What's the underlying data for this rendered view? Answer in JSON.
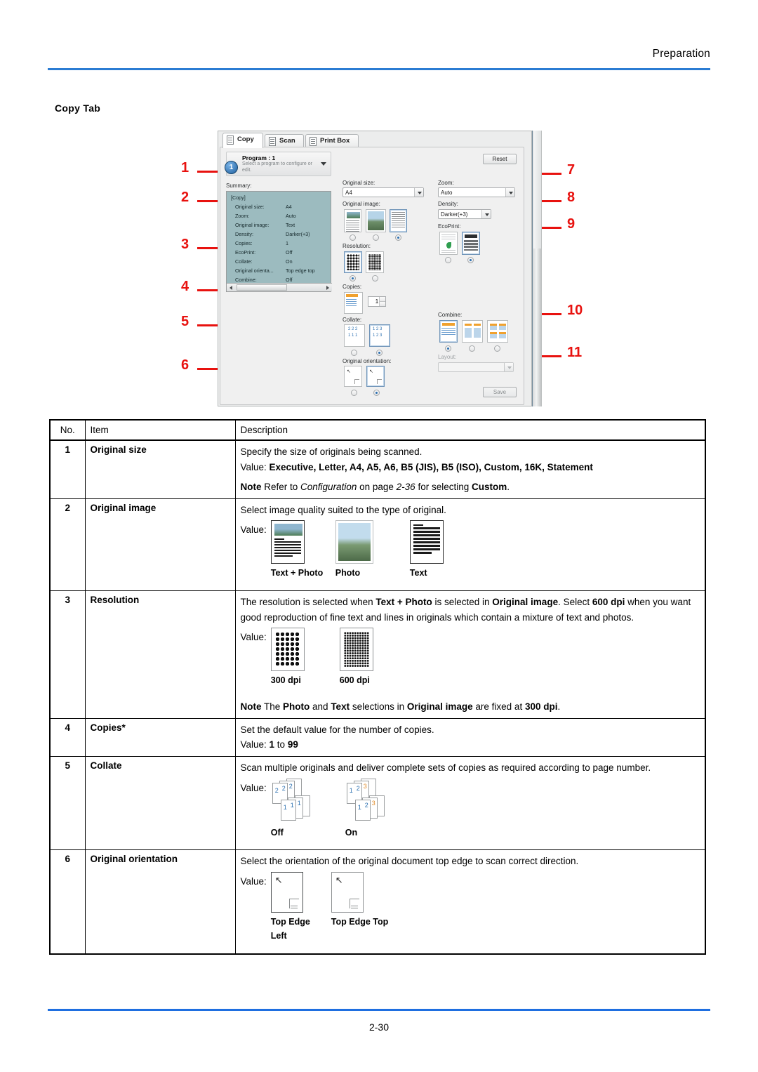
{
  "page": {
    "header_title": "Preparation",
    "section_title": "Copy Tab",
    "footer_page": "2-30",
    "accent_color": "#2b7cd3",
    "callout_color": "#e8120f"
  },
  "callouts": {
    "left": [
      "1",
      "2",
      "3",
      "4",
      "5",
      "6"
    ],
    "right": [
      "7",
      "8",
      "9",
      "10",
      "11"
    ]
  },
  "screenshot": {
    "tabs": [
      {
        "label": "Copy",
        "icon": "document-icon",
        "active": true
      },
      {
        "label": "Scan",
        "icon": "scanner-icon",
        "active": false
      },
      {
        "label": "Print Box",
        "icon": "printbox-icon",
        "active": false
      }
    ],
    "program": {
      "title": "Program : 1",
      "subtitle": "Select a program to configure or edit.",
      "badge": "1"
    },
    "reset_button": "Reset",
    "save_button": "Save",
    "summary": {
      "label": "Summary:",
      "group": "[Copy]",
      "rows": [
        {
          "key": "Original size:",
          "value": "A4"
        },
        {
          "key": "Zoom:",
          "value": "Auto"
        },
        {
          "key": "Original image:",
          "value": "Text"
        },
        {
          "key": "Density:",
          "value": "Darker(+3)"
        },
        {
          "key": "Copies:",
          "value": "1"
        },
        {
          "key": "EcoPrint:",
          "value": "Off"
        },
        {
          "key": "Collate:",
          "value": "On"
        },
        {
          "key": "Original orienta...",
          "value": "Top edge top"
        },
        {
          "key": "Combine:",
          "value": "Off"
        }
      ]
    },
    "fields": {
      "original_size_label": "Original size:",
      "original_size_value": "A4",
      "original_image_label": "Original image:",
      "resolution_label": "Resolution:",
      "copies_label": "Copies:",
      "copies_value": "1",
      "collate_label": "Collate:",
      "original_orientation_label": "Original orientation:",
      "zoom_label": "Zoom:",
      "zoom_value": "Auto",
      "density_label": "Density:",
      "density_value": "Darker(+3)",
      "ecoprint_label": "EcoPrint:",
      "combine_label": "Combine:",
      "layout_label": "Layout:",
      "layout_value": ""
    }
  },
  "table": {
    "headers": {
      "no": "No.",
      "item": "Item",
      "description": "Description"
    },
    "rows": [
      {
        "no": "1",
        "item": "Original size",
        "line1": "Specify the size of originals being scanned.",
        "value_prefix": "Value: ",
        "value_bold": "Executive, Letter, A4, A5, A6, B5 (JIS), B5 (ISO), Custom, 16K, Statement",
        "note_label": "Note",
        "note_pre": "  Refer to ",
        "note_italic": "Configuration",
        "note_mid": " on page ",
        "note_italic2": "2-36",
        "note_post": " for selecting ",
        "note_bold": "Custom",
        "note_end": "."
      },
      {
        "no": "2",
        "item": "Original image",
        "line1": "Select image quality suited to the type of original.",
        "value_label": "Value:",
        "options": [
          {
            "caption": "Text + Photo",
            "art": "text-photo-icon"
          },
          {
            "caption": "Photo",
            "art": "photo-icon"
          },
          {
            "caption": "Text",
            "art": "text-icon"
          }
        ]
      },
      {
        "no": "3",
        "item": "Resolution",
        "p_a": "The resolution is selected when ",
        "p_b": "Text + Photo",
        "p_c": " is selected in ",
        "p_d": "Original image",
        "p_e": ". Select ",
        "p_f": "600 dpi",
        "p_g": " when you want good reproduction of fine text and lines in originals which contain a mixture of text and photos.",
        "value_label": "Value:",
        "options": [
          {
            "caption": "300 dpi",
            "art": "halftone-300-icon"
          },
          {
            "caption": "600 dpi",
            "art": "halftone-600-icon"
          }
        ],
        "note_label": "Note",
        "n_a": "  The ",
        "n_b": "Photo",
        "n_c": " and ",
        "n_d": "Text",
        "n_e": " selections in ",
        "n_f": "Original image",
        "n_g": " are fixed at ",
        "n_h": "300 dpi",
        "n_i": "."
      },
      {
        "no": "4",
        "item": "Copies*",
        "line1": "Set the default value for the number of copies.",
        "v_a": "Value: ",
        "v_b": "1",
        "v_c": " to ",
        "v_d": "99"
      },
      {
        "no": "5",
        "item": "Collate",
        "line1": "Scan multiple originals and deliver complete sets of copies as required according to page number.",
        "value_label": "Value:",
        "options": [
          {
            "caption": "Off",
            "art": "collate-off-icon"
          },
          {
            "caption": "On",
            "art": "collate-on-icon"
          }
        ]
      },
      {
        "no": "6",
        "item": "Original orientation",
        "line1": "Select the orientation of the original document top edge to scan correct direction.",
        "value_label": "Value:",
        "options": [
          {
            "caption": "Top Edge Left",
            "art": "top-edge-left-icon"
          },
          {
            "caption": "Top Edge Top",
            "art": "top-edge-top-icon"
          }
        ]
      }
    ]
  }
}
